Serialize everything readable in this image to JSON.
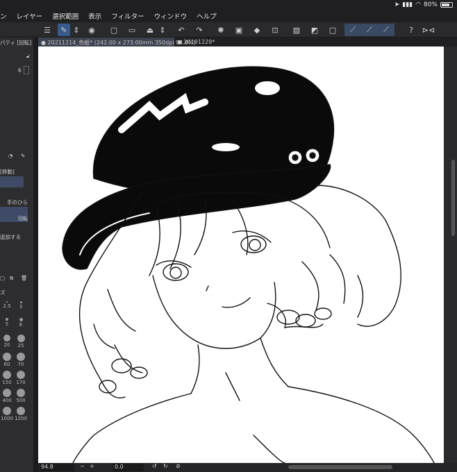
{
  "status": {
    "battery_text": "80%",
    "battery_level": 0.8
  },
  "menu": [
    "ン",
    "レイヤー",
    "選択範囲",
    "表示",
    "フィルター",
    "ウィンドウ",
    "ヘルプ"
  ],
  "tabs": [
    {
      "label": "20211214_色紙* (242.00 x 273.00mm 350dpi 94.8%)",
      "active": true
    },
    {
      "label": "20191229*",
      "active": false
    }
  ],
  "left_panel": {
    "property_label": "パティ [回転]",
    "value_6": "6",
    "move_label": "[移動]",
    "hand_label": "手のひら",
    "rotate_label": "回転",
    "add_label": "追加する",
    "brush_title": "ズ",
    "brush_sizes": [
      "2.5",
      "3",
      "5",
      "6",
      "20",
      "25",
      "60",
      "70",
      "150",
      "170",
      "400",
      "500",
      "1000",
      "1200"
    ]
  },
  "bottom": {
    "zoom_value": "94.8",
    "minus_label": "−",
    "plus_label": "+",
    "angle_value": "0.0"
  },
  "icons": {
    "toolbar": [
      "menu-icon",
      "new-canvas-icon",
      "stepper-icon",
      "camera-icon",
      "new-file-icon",
      "open-folder-icon",
      "save-icon",
      "cloud-stepper-icon",
      "undo-icon",
      "redo-icon",
      "loading-icon",
      "layer-icon",
      "fill-icon",
      "transform-icon",
      "blank-icon",
      "blank2-icon",
      "square-icon",
      "pen-stabilize-icon",
      "pen2-icon",
      "pen3-icon",
      "help-icon",
      "flip-icon"
    ]
  }
}
